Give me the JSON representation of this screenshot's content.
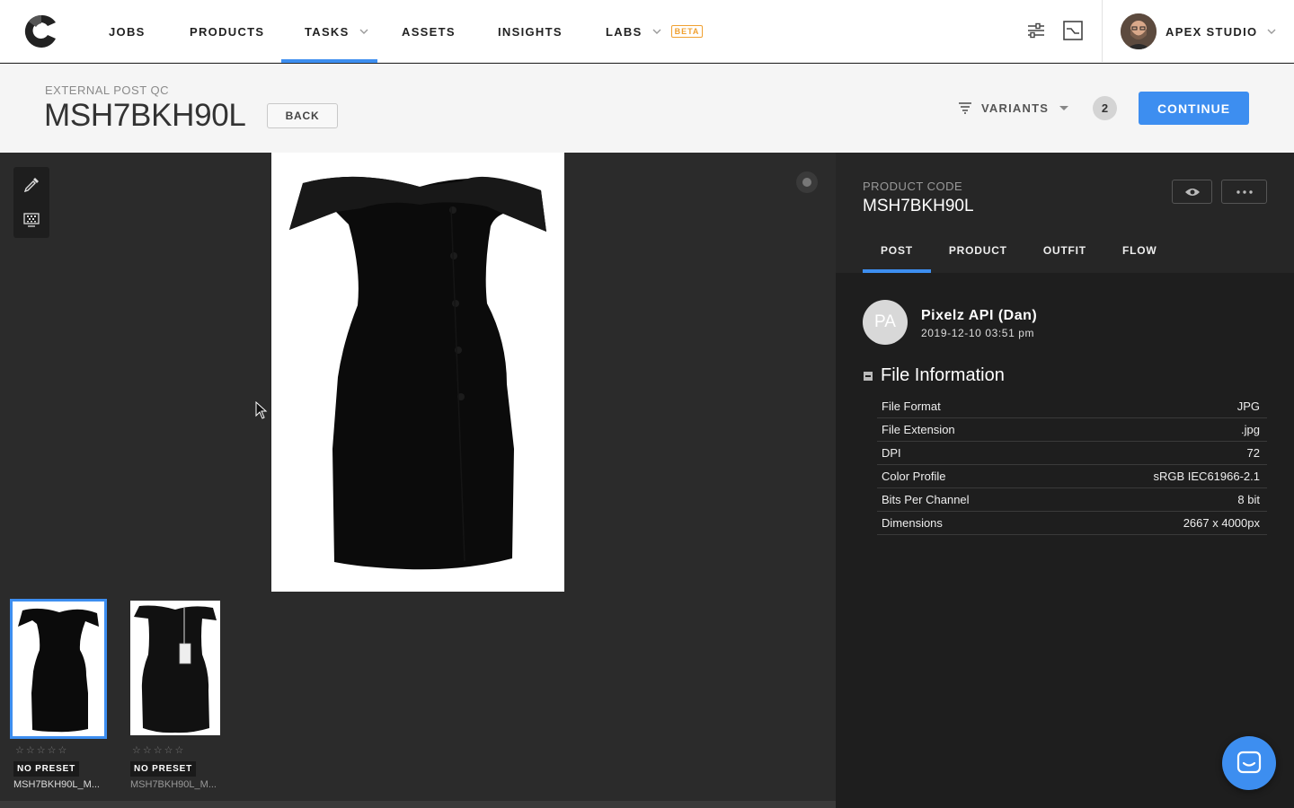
{
  "nav": {
    "items": [
      {
        "label": "JOBS"
      },
      {
        "label": "PRODUCTS"
      },
      {
        "label": "TASKS"
      },
      {
        "label": "ASSETS"
      },
      {
        "label": "INSIGHTS"
      },
      {
        "label": "LABS",
        "badge": "BETA"
      }
    ],
    "active": "TASKS",
    "studio_name": "APEX STUDIO"
  },
  "header": {
    "subtitle": "EXTERNAL POST QC",
    "title": "MSH7BKH90L",
    "back_label": "BACK",
    "variants_label": "VARIANTS",
    "variant_count": "2",
    "continue_label": "CONTINUE"
  },
  "thumbnails": [
    {
      "stars": "☆☆☆☆☆",
      "preset": "NO PRESET",
      "name": "MSH7BKH90L_M..."
    },
    {
      "stars": "☆☆☆☆☆",
      "preset": "NO PRESET",
      "name": "MSH7BKH90L_M..."
    }
  ],
  "panel": {
    "product_code_label": "PRODUCT CODE",
    "product_code": "MSH7BKH90L",
    "tabs": [
      {
        "label": "POST"
      },
      {
        "label": "PRODUCT"
      },
      {
        "label": "OUTFIT"
      },
      {
        "label": "FLOW"
      }
    ],
    "active_tab": "POST",
    "author": {
      "initials": "PA",
      "name": "Pixelz API (Dan)",
      "date": "2019-12-10 03:51 pm"
    },
    "file_info": {
      "title": "File Information",
      "rows": [
        {
          "label": "File Format",
          "value": "JPG"
        },
        {
          "label": "File Extension",
          "value": ".jpg"
        },
        {
          "label": "DPI",
          "value": "72"
        },
        {
          "label": "Color Profile",
          "value": "sRGB IEC61966-2.1"
        },
        {
          "label": "Bits Per Channel",
          "value": "8 bit"
        },
        {
          "label": "Dimensions",
          "value": "2667 x 4000px"
        }
      ]
    }
  },
  "colors": {
    "accent": "#3d8ef0",
    "beta": "#f0a030",
    "panel_bg": "#1e1e1e",
    "canvas_bg": "#2b2b2b"
  }
}
